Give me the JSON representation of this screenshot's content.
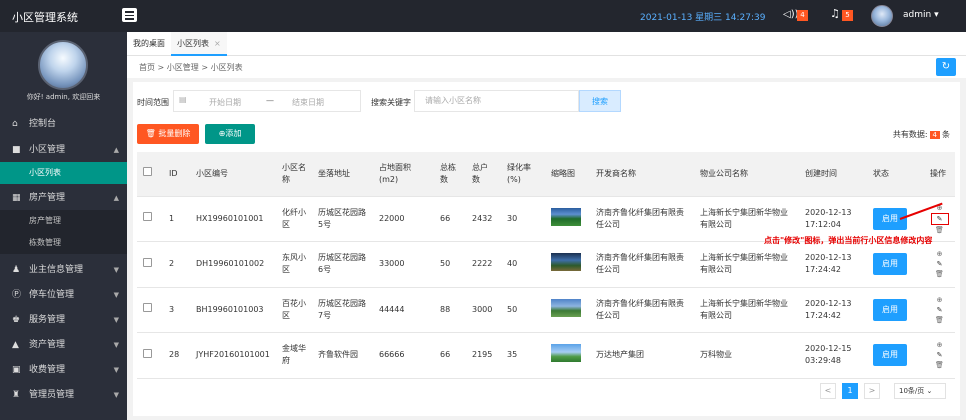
{
  "app": {
    "title": "小区管理系统"
  },
  "topbar": {
    "datetime": "2021-01-13  星期三  14:27:39",
    "volume_badge": "4",
    "bell_badge": "5",
    "username": "admin"
  },
  "sidebar": {
    "welcome": "你好! admin, 欢迎回来",
    "items": [
      {
        "label": "控制台",
        "icon": "home-icon"
      },
      {
        "label": "小区管理",
        "icon": "building-icon"
      },
      {
        "label": "小区列表"
      },
      {
        "label": "房产管理",
        "icon": "house-icon"
      },
      {
        "label": "房产管理"
      },
      {
        "label": "栋数管理"
      },
      {
        "label": "业主信息管理",
        "icon": "people-icon"
      },
      {
        "label": "停车位管理",
        "icon": "parking-icon"
      },
      {
        "label": "服务管理",
        "icon": "service-icon"
      },
      {
        "label": "资产管理",
        "icon": "asset-icon"
      },
      {
        "label": "收费管理",
        "icon": "fee-icon"
      },
      {
        "label": "管理员管理",
        "icon": "admin-icon"
      }
    ]
  },
  "tabs": [
    {
      "label": "我的桌面"
    },
    {
      "label": "小区列表",
      "close": "×"
    }
  ],
  "breadcrumb": "首页  >  小区管理  >  小区列表",
  "filters": {
    "range_label": "时间范围",
    "start_placeholder": "开始日期",
    "dash": "—",
    "end_placeholder": "结束日期",
    "keyword_label": "搜索关键字",
    "keyword_placeholder": "请输入小区名称",
    "search_label": "搜索"
  },
  "actions": {
    "batch_delete": "批量删除",
    "add": "添加",
    "total_label": "共有数据:",
    "total_count": "4",
    "total_unit": "条"
  },
  "table": {
    "headers": [
      "",
      "ID",
      "小区编号",
      "小区名称",
      "坐落地址",
      "占地面积(m2)",
      "总栋数",
      "总户数",
      "绿化率(%)",
      "缩略图",
      "开发商名称",
      "物业公司名称",
      "创建时间",
      "状态",
      "操作"
    ],
    "rows": [
      {
        "id": "1",
        "code": "HX19960101001",
        "name": "化纤小区",
        "addr": "历城区花园路5号",
        "area": "22000",
        "buildings": "66",
        "households": "2432",
        "green": "30",
        "dev": "济南齐鲁化纤集团有限责任公司",
        "prop": "上海新长宁集团新华物业有限公司",
        "created": "2020-12-13 17:12:04",
        "status": "启用"
      },
      {
        "id": "2",
        "code": "DH19960101002",
        "name": "东风小区",
        "addr": "历城区花园路6号",
        "area": "33000",
        "buildings": "50",
        "households": "2222",
        "green": "40",
        "dev": "济南齐鲁化纤集团有限责任公司",
        "prop": "上海新长宁集团新华物业有限公司",
        "created": "2020-12-13 17:24:42",
        "status": "启用"
      },
      {
        "id": "3",
        "code": "BH19960101003",
        "name": "百花小区",
        "addr": "历城区花园路7号",
        "area": "44444",
        "buildings": "88",
        "households": "3000",
        "green": "50",
        "dev": "济南齐鲁化纤集团有限责任公司",
        "prop": "上海新长宁集团新华物业有限公司",
        "created": "2020-12-13 17:24:42",
        "status": "启用"
      },
      {
        "id": "28",
        "code": "JYHF20160101001",
        "name": "金域华府",
        "addr": "齐鲁软件园",
        "area": "66666",
        "buildings": "66",
        "households": "2195",
        "green": "35",
        "dev": "万达地产集团",
        "prop": "万科物业",
        "created": "2020-12-15 03:29:48",
        "status": "启用"
      }
    ]
  },
  "annotation": "点击\"修改\"图标，弹出当前行小区信息修改内容",
  "pager": {
    "prev": "<",
    "current": "1",
    "next": ">",
    "size": "10条/页"
  }
}
